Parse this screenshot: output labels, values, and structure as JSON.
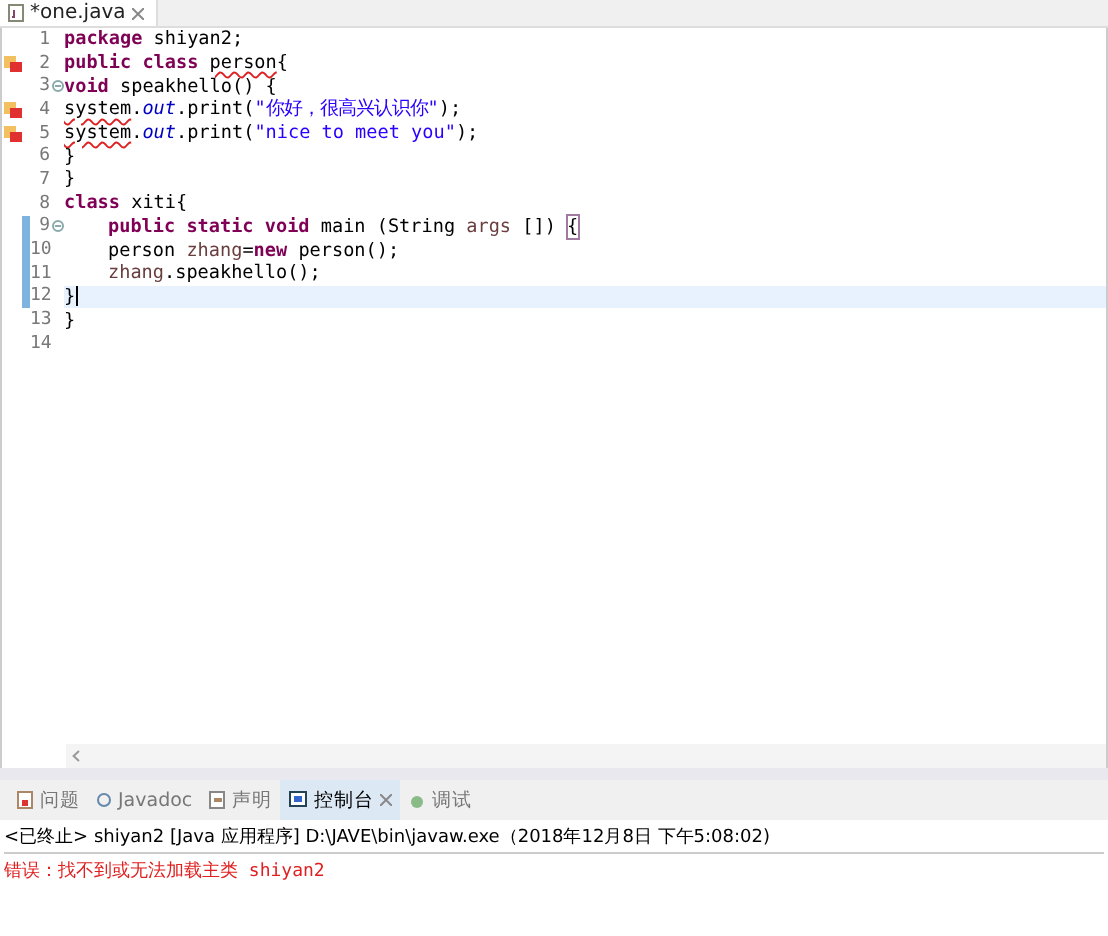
{
  "editor_tab": {
    "title": "*one.java",
    "selected": true
  },
  "lines": [
    {
      "number": "1",
      "error": false,
      "fold": false,
      "changed": false,
      "current": false,
      "indented": false,
      "tokens": [
        {
          "text": "package ",
          "kind": "keyword"
        },
        {
          "text": "shiyan2;",
          "kind": "plain"
        }
      ]
    },
    {
      "number": "2",
      "error": true,
      "fold": false,
      "changed": false,
      "current": false,
      "indented": false,
      "tokens": [
        {
          "text": "public ",
          "kind": "keyword"
        },
        {
          "text": "class ",
          "kind": "keyword"
        },
        {
          "text": "person",
          "kind": "error"
        },
        {
          "text": "{",
          "kind": "plain"
        }
      ]
    },
    {
      "number": "3",
      "error": false,
      "fold": true,
      "changed": false,
      "current": false,
      "indented": false,
      "tokens": [
        {
          "text": "void ",
          "kind": "keyword"
        },
        {
          "text": "speakhello() {",
          "kind": "plain"
        }
      ]
    },
    {
      "number": "4",
      "error": true,
      "fold": false,
      "changed": false,
      "current": false,
      "indented": false,
      "tokens": [
        {
          "text": "system",
          "kind": "error"
        },
        {
          "text": ".",
          "kind": "plain"
        },
        {
          "text": "out",
          "kind": "field"
        },
        {
          "text": ".print(",
          "kind": "plain"
        },
        {
          "text": "\"你好，很高兴认识你\"",
          "kind": "string"
        },
        {
          "text": ");",
          "kind": "plain"
        }
      ]
    },
    {
      "number": "5",
      "error": true,
      "fold": false,
      "changed": false,
      "current": false,
      "indented": false,
      "tokens": [
        {
          "text": "system",
          "kind": "error"
        },
        {
          "text": ".",
          "kind": "plain"
        },
        {
          "text": "out",
          "kind": "field"
        },
        {
          "text": ".print(",
          "kind": "plain"
        },
        {
          "text": "\"nice to meet you\"",
          "kind": "string"
        },
        {
          "text": ");",
          "kind": "plain"
        }
      ]
    },
    {
      "number": "6",
      "error": false,
      "fold": false,
      "changed": false,
      "current": false,
      "indented": false,
      "tokens": [
        {
          "text": "}",
          "kind": "plain"
        }
      ]
    },
    {
      "number": "7",
      "error": false,
      "fold": false,
      "changed": false,
      "current": false,
      "indented": false,
      "tokens": [
        {
          "text": "}",
          "kind": "plain"
        }
      ]
    },
    {
      "number": "8",
      "error": false,
      "fold": false,
      "changed": false,
      "current": false,
      "indented": false,
      "tokens": [
        {
          "text": "class ",
          "kind": "keyword"
        },
        {
          "text": "xiti{",
          "kind": "plain"
        }
      ]
    },
    {
      "number": "9",
      "error": false,
      "fold": true,
      "changed": true,
      "current": false,
      "indented": true,
      "tokens": [
        {
          "text": "public ",
          "kind": "keyword"
        },
        {
          "text": "static ",
          "kind": "keyword"
        },
        {
          "text": "void ",
          "kind": "keyword"
        },
        {
          "text": "main (String ",
          "kind": "plain"
        },
        {
          "text": "args",
          "kind": "variable"
        },
        {
          "text": " []) ",
          "kind": "plain"
        },
        {
          "text": "{",
          "kind": "bracket"
        }
      ]
    },
    {
      "number": "10",
      "error": false,
      "fold": false,
      "changed": true,
      "current": false,
      "indented": true,
      "tokens": [
        {
          "text": "person ",
          "kind": "plain"
        },
        {
          "text": "zhang",
          "kind": "variable"
        },
        {
          "text": "=",
          "kind": "plain"
        },
        {
          "text": "new",
          "kind": "keyword"
        },
        {
          "text": " person();",
          "kind": "plain"
        }
      ]
    },
    {
      "number": "11",
      "error": false,
      "fold": false,
      "changed": true,
      "current": false,
      "indented": true,
      "tokens": [
        {
          "text": "zhang",
          "kind": "variable"
        },
        {
          "text": ".speakhello();",
          "kind": "plain"
        }
      ]
    },
    {
      "number": "12",
      "error": false,
      "fold": false,
      "changed": true,
      "current": true,
      "indented": false,
      "tokens": [
        {
          "text": "}",
          "kind": "plain"
        }
      ]
    },
    {
      "number": "13",
      "error": false,
      "fold": false,
      "changed": false,
      "current": false,
      "indented": false,
      "tokens": [
        {
          "text": "}",
          "kind": "plain"
        }
      ]
    },
    {
      "number": "14",
      "error": false,
      "fold": false,
      "changed": false,
      "current": false
    }
  ],
  "panel_tabs": [
    {
      "label": "问题",
      "kind": "problems",
      "selected": false
    },
    {
      "label": "Javadoc",
      "kind": "javadoc",
      "selected": false
    },
    {
      "label": "声明",
      "kind": "declaration",
      "selected": false
    },
    {
      "label": "控制台",
      "kind": "console",
      "selected": true
    },
    {
      "label": "调试",
      "kind": "debug",
      "selected": false
    }
  ],
  "console": {
    "header": "<已终止> shiyan2 [Java 应用程序] D:\\JAVE\\bin\\javaw.exe（2018年12月8日 下午5:08:02)",
    "lines": [
      {
        "text": "错误：找不到或无法加载主类 shiyan2",
        "kind": "error"
      }
    ]
  }
}
